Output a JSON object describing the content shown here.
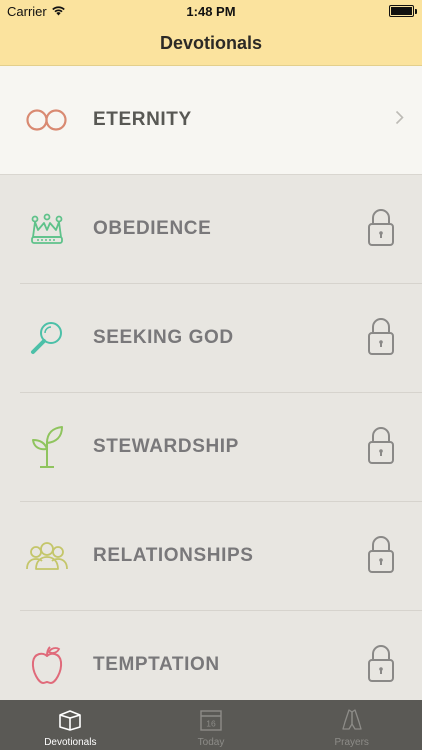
{
  "status_bar": {
    "carrier": "Carrier",
    "time": "1:48 PM"
  },
  "nav": {
    "title": "Devotionals"
  },
  "rows": [
    {
      "label": "ETERNITY",
      "icon": "infinity-icon",
      "icon_color": "#d98a72",
      "state": "unlocked"
    },
    {
      "label": "OBEDIENCE",
      "icon": "crown-icon",
      "icon_color": "#5fc28a",
      "state": "locked"
    },
    {
      "label": "SEEKING GOD",
      "icon": "magnifier-icon",
      "icon_color": "#4cc0a8",
      "state": "locked"
    },
    {
      "label": "STEWARDSHIP",
      "icon": "sprout-icon",
      "icon_color": "#8fc45e",
      "state": "locked"
    },
    {
      "label": "RELATIONSHIPS",
      "icon": "people-icon",
      "icon_color": "#c4c66a",
      "state": "locked"
    },
    {
      "label": "TEMPTATION",
      "icon": "apple-icon",
      "icon_color": "#e06a7a",
      "state": "locked"
    }
  ],
  "tabs": [
    {
      "label": "Devotionals",
      "icon": "book-icon",
      "active": true
    },
    {
      "label": "Today",
      "icon": "calendar-icon",
      "calendar_day": "16",
      "active": false
    },
    {
      "label": "Prayers",
      "icon": "praying-hands-icon",
      "active": false
    }
  ],
  "colors": {
    "header": "#fbe39e",
    "tab_bar": "#5a5955",
    "locked_bg": "#e8e6e1",
    "unlocked_bg": "#f7f6f2"
  }
}
